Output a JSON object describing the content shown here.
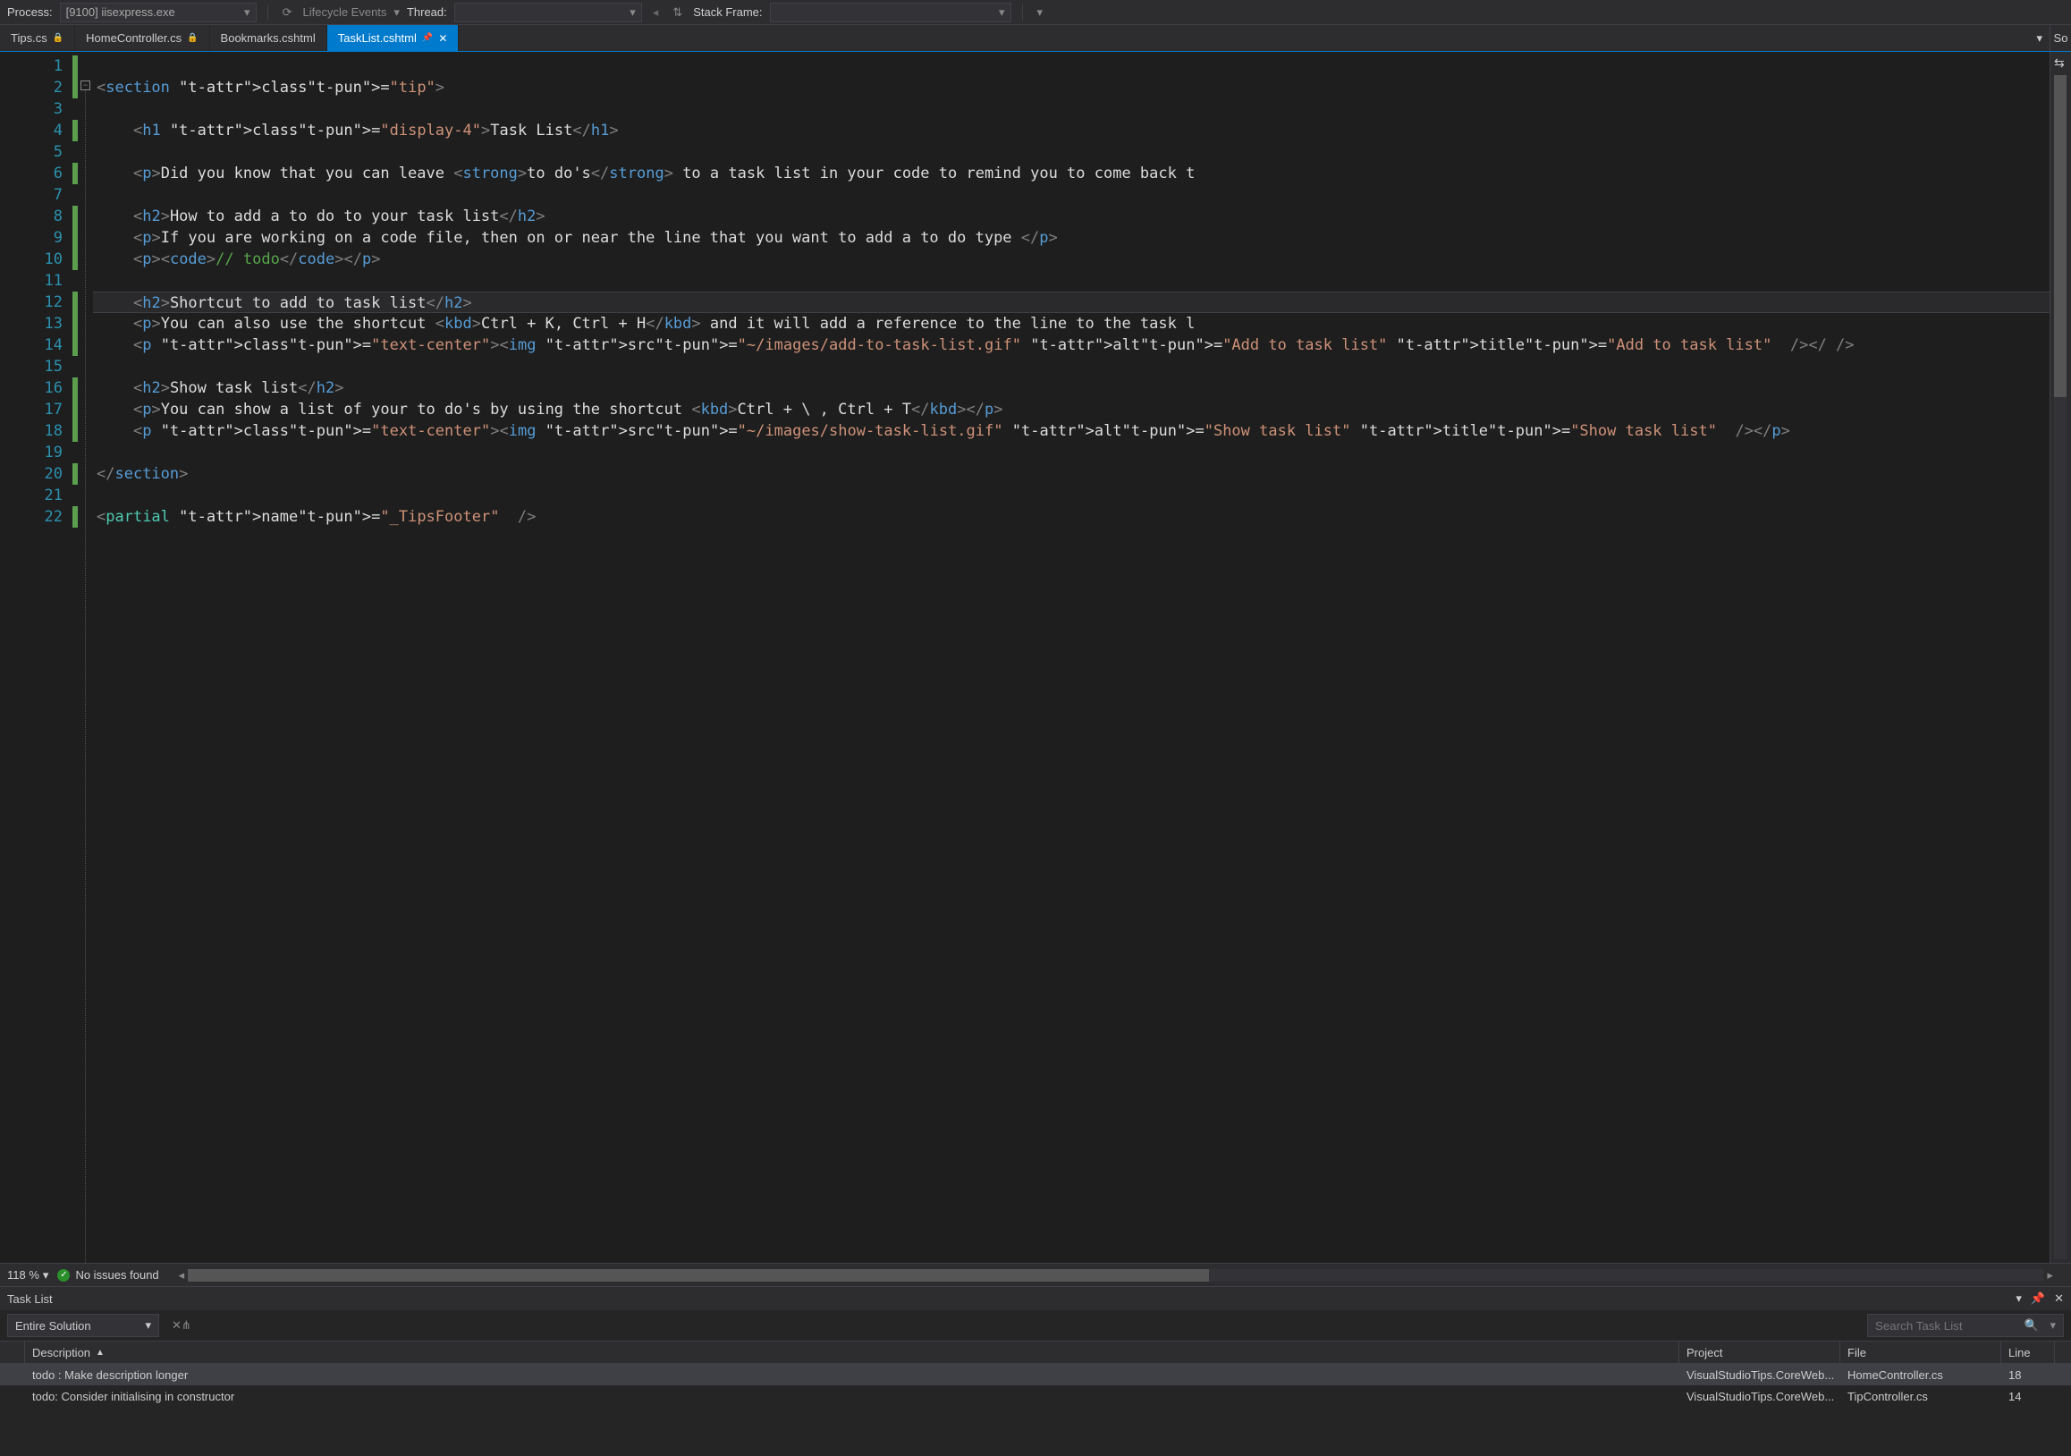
{
  "toolbar": {
    "process_label": "Process:",
    "process_value": "[9100] iisexpress.exe",
    "lifecycle_label": "Lifecycle Events",
    "thread_label": "Thread:",
    "thread_value": "",
    "stackframe_label": "Stack Frame:",
    "stackframe_value": ""
  },
  "tabs": [
    {
      "label": "Tips.cs",
      "locked": true,
      "active": false
    },
    {
      "label": "HomeController.cs",
      "locked": true,
      "active": false
    },
    {
      "label": "Bookmarks.cshtml",
      "locked": false,
      "active": false
    },
    {
      "label": "TaskList.cshtml",
      "locked": false,
      "active": true,
      "pinned": true
    }
  ],
  "right_panel_hint": "So",
  "editor": {
    "lines": [
      "",
      "<section class=\"tip\">",
      "",
      "    <h1 class=\"display-4\">Task List</h1>",
      "",
      "    <p>Did you know that you can leave <strong>to do's</strong> to a task list in your code to remind you to come back t",
      "",
      "    <h2>How to add a to do to your task list</h2>",
      "    <p>If you are working on a code file, then on or near the line that you want to add a to do type </p>",
      "    <p><code>// todo</code></p>",
      "",
      "    <h2>Shortcut to add to task list</h2>",
      "    <p>You can also use the shortcut <kbd>Ctrl + K, Ctrl + H</kbd> and it will add a reference to the line to the task l",
      "    <p class=\"text-center\"><img src=\"~/images/add-to-task-list.gif\" alt=\"Add to task list\" title=\"Add to task list\" /></",
      "",
      "    <h2>Show task list</h2>",
      "    <p>You can show a list of your to do's by using the shortcut <kbd>Ctrl + \\ , Ctrl + T</kbd></p>",
      "    <p class=\"text-center\"><img src=\"~/images/show-task-list.gif\" alt=\"Show task list\" title=\"Show task list\" /></p>",
      "",
      "</section>",
      "",
      "<partial name=\"_TipsFooter\" />"
    ],
    "highlighted_line": 12,
    "changed_lines": [
      1,
      2,
      4,
      6,
      8,
      9,
      10,
      12,
      13,
      14,
      16,
      17,
      18,
      20,
      22
    ]
  },
  "editor_status": {
    "zoom": "118 %",
    "issues": "No issues found"
  },
  "tasklist": {
    "title": "Task List",
    "scope": "Entire Solution",
    "search_placeholder": "Search Task List",
    "columns": {
      "description": "Description",
      "project": "Project",
      "file": "File",
      "line": "Line"
    },
    "rows": [
      {
        "description": "todo : Make description longer",
        "project": "VisualStudioTips.CoreWeb...",
        "file": "HomeController.cs",
        "line": "18",
        "selected": true
      },
      {
        "description": "todo: Consider initialising in constructor",
        "project": "VisualStudioTips.CoreWeb...",
        "file": "TipController.cs",
        "line": "14",
        "selected": false
      }
    ]
  }
}
